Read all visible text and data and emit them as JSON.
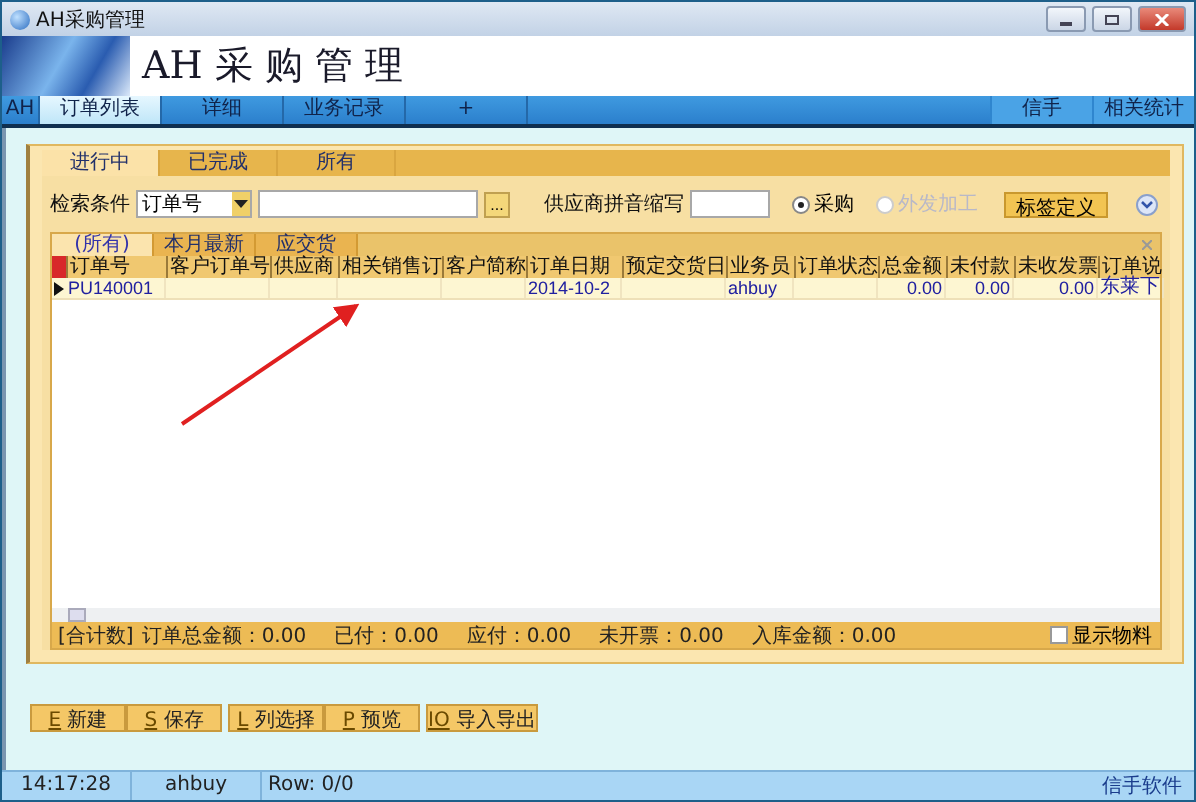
{
  "window": {
    "title": "AH采购管理"
  },
  "banner": {
    "title": "AH 采 购 管 理"
  },
  "main_tabs": [
    {
      "label": "AH",
      "selected": false
    },
    {
      "label": "订单列表",
      "selected": true
    },
    {
      "label": "详细",
      "selected": false
    },
    {
      "label": "业务记录",
      "selected": false
    },
    {
      "label": "+",
      "selected": false
    }
  ],
  "right_tabs": [
    "信手",
    "相关统计"
  ],
  "order_tabs": [
    {
      "label": "进行中",
      "selected": true
    },
    {
      "label": "已完成",
      "selected": false
    },
    {
      "label": "所有",
      "selected": false
    }
  ],
  "search": {
    "label": "检索条件",
    "field": "订单号",
    "browse": "...",
    "pinyin_label": "供应商拼音缩写",
    "radios": [
      {
        "label": "采购",
        "selected": true,
        "disabled": false
      },
      {
        "label": "外发加工",
        "selected": false,
        "disabled": true
      }
    ],
    "define_button": "标签定义"
  },
  "grid_tabs": [
    {
      "label": "(所有)",
      "selected": true
    },
    {
      "label": "本月最新",
      "selected": false
    },
    {
      "label": "应交货",
      "selected": false
    }
  ],
  "table": {
    "columns": [
      "订单号",
      "客户订单号",
      "供应商",
      "相关销售订",
      "客户简称",
      "订单日期",
      "预定交货日",
      "业务员",
      "订单状态",
      "总金额",
      "未付款",
      "未收发票",
      "订单说"
    ],
    "rows": [
      {
        "current": true,
        "cells": [
          "PU140001",
          "",
          "",
          "",
          "",
          "2014-10-2",
          "",
          "ahbuy",
          "",
          "0.00",
          "0.00",
          "0.00",
          "东莱下"
        ]
      }
    ]
  },
  "totals": [
    "[合计数]",
    "订单总金额：0.00",
    "已付：0.00",
    "应付：0.00",
    "未开票：0.00",
    "入库金额：0.00"
  ],
  "show_materials": {
    "label": "显示物料",
    "checked": false
  },
  "buttons": [
    {
      "key": "E",
      "label": "新建"
    },
    {
      "key": "S",
      "label": "保存"
    },
    {
      "key": "L",
      "label": "列选择"
    },
    {
      "key": "P",
      "label": "预览"
    },
    {
      "key": "IO",
      "label": "导入导出"
    }
  ],
  "status_bar": [
    "14:17:28",
    "ahbuy",
    "Row: 0/0"
  ],
  "vendor": "信手软件"
}
